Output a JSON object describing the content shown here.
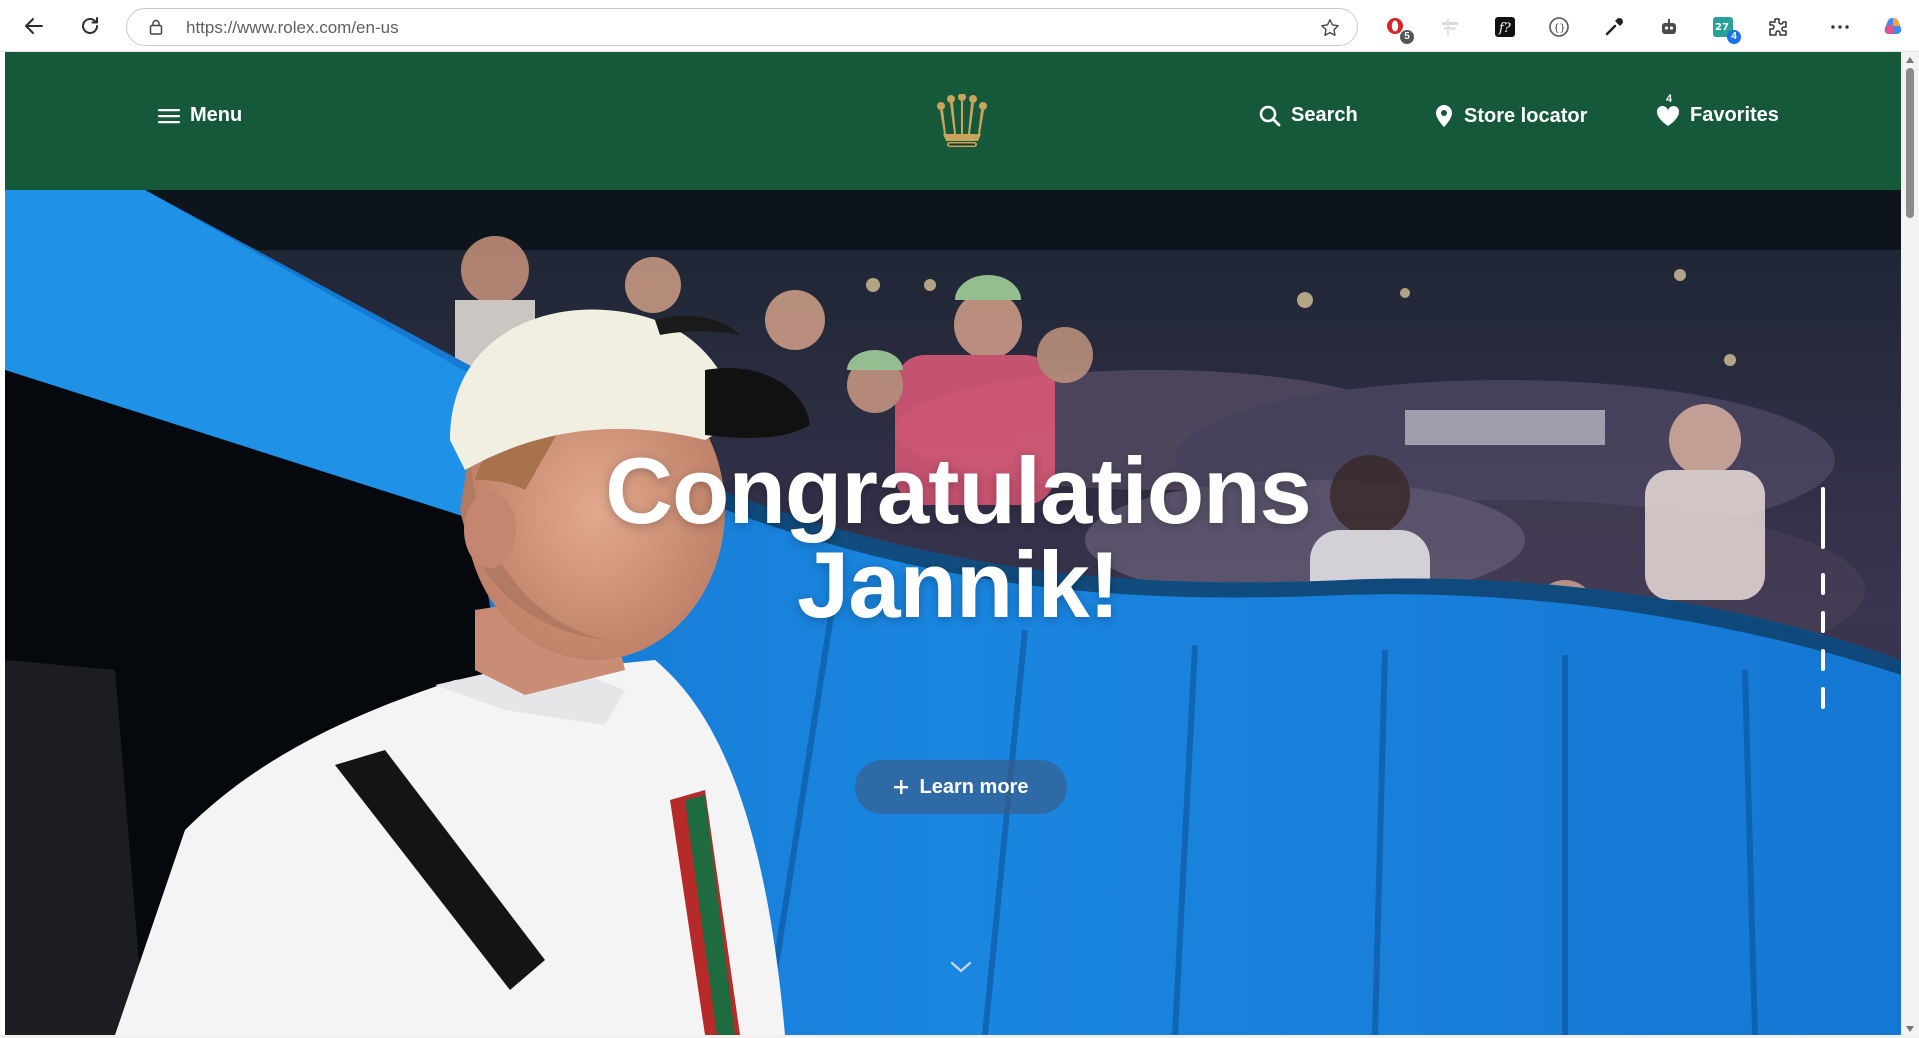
{
  "browser": {
    "url_host": "https://www.rolex.com",
    "url_path": "/en-us",
    "extensions": [
      {
        "name": "opera-extension-icon",
        "badge": "5",
        "badge_color": "#555555"
      },
      {
        "name": "faded-extension-icon",
        "badge": ""
      },
      {
        "name": "font-extension-icon",
        "badge": ""
      },
      {
        "name": "code-brackets-extension-icon",
        "badge": ""
      },
      {
        "name": "eyedropper-extension-icon",
        "badge": ""
      },
      {
        "name": "robot-extension-icon",
        "badge": ""
      },
      {
        "name": "translate-extension-icon",
        "badge": "4",
        "badge_color": "#1a73e8"
      },
      {
        "name": "puzzle-extensions-icon",
        "badge": ""
      }
    ]
  },
  "header": {
    "menu_label": "Menu",
    "search_label": "Search",
    "store_locator_label": "Store locator",
    "favorites_label": "Favorites",
    "favorites_count": "4",
    "brand_color": "#16593a",
    "crown_color": "#c8a45c"
  },
  "hero": {
    "title_line1": "Congratulations",
    "title_line2": "Jannik!",
    "cta_label": "Learn more"
  }
}
